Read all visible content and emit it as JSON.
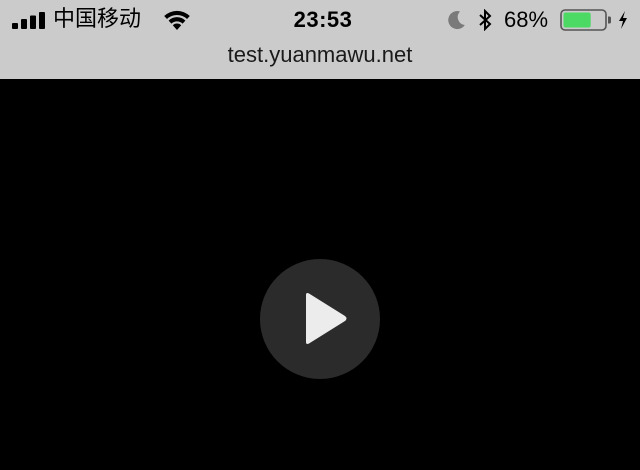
{
  "status_bar": {
    "carrier": "中国移动",
    "time": "23:53",
    "battery_percent": "68%",
    "battery_level": 0.68,
    "battery_color": "#4cd964",
    "icons": [
      "signal-icon",
      "wifi-icon",
      "moon-icon",
      "bluetooth-icon",
      "battery-icon",
      "charging-icon"
    ]
  },
  "browser": {
    "url": "test.yuanmawu.net",
    "bar_color": "#cbcbcb"
  },
  "video": {
    "background": "#000000",
    "play_button_icon": "play-icon",
    "play_button_color": "#2b2b2b"
  }
}
